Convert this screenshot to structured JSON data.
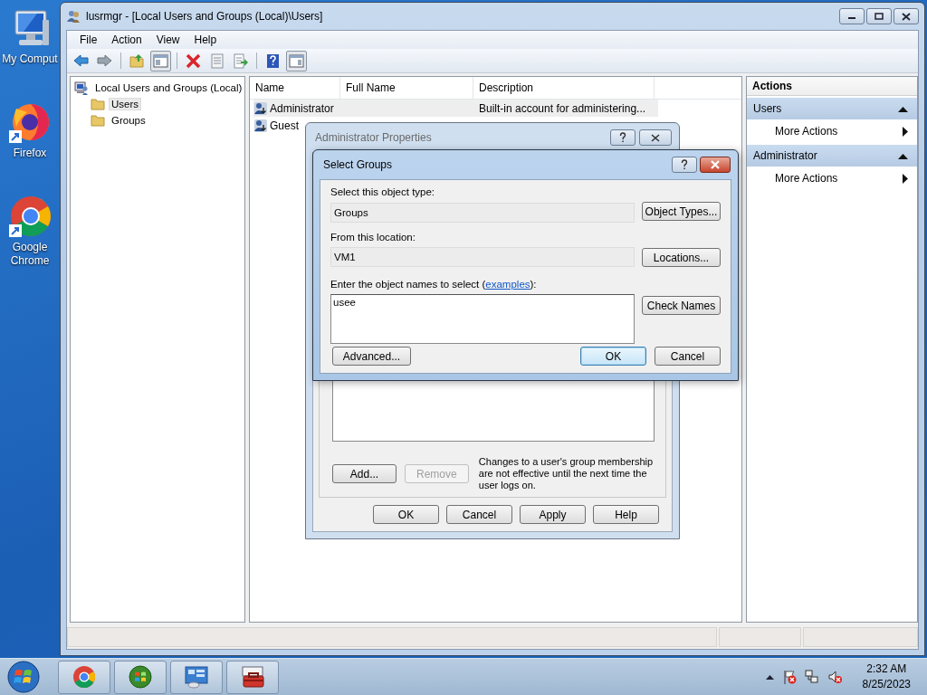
{
  "desktop_icons": [
    {
      "label": "My Comput",
      "kind": "computer"
    },
    {
      "label": "Firefox",
      "kind": "firefox"
    },
    {
      "label": "Google Chrome",
      "kind": "chrome"
    }
  ],
  "main_window": {
    "title": "lusrmgr - [Local Users and Groups (Local)\\Users]",
    "menu": [
      "File",
      "Action",
      "View",
      "Help"
    ],
    "tree": {
      "label": "Local Users and Groups (Local)",
      "children": [
        {
          "label": "Users",
          "selected": true
        },
        {
          "label": "Groups",
          "selected": false
        }
      ]
    },
    "list": {
      "columns": [
        "Name",
        "Full Name",
        "Description"
      ],
      "rows": [
        {
          "name": "Administrator",
          "description": "Built-in account for administering...",
          "selected": true
        },
        {
          "name": "Guest",
          "selected": false
        }
      ]
    },
    "actions": {
      "title": "Actions",
      "sections": [
        {
          "title": "Users",
          "expanded": true,
          "items": [
            "More Actions"
          ]
        },
        {
          "title": "Administrator",
          "expanded": true,
          "items": [
            "More Actions"
          ]
        }
      ]
    }
  },
  "properties_dialog": {
    "title": "Administrator Properties",
    "member_buttons": [
      {
        "label": "Add...",
        "disabled": false
      },
      {
        "label": "Remove",
        "disabled": true
      }
    ],
    "note": "Changes to a user's group membership are not effective until the next time the user logs on.",
    "buttons": [
      "OK",
      "Cancel",
      "Apply",
      "Help"
    ]
  },
  "select_dialog": {
    "title": "Select Groups",
    "object_type_label": "Select this object type:",
    "object_type": "Groups",
    "object_types_button": "Object Types...",
    "location_label": "From this location:",
    "location": "VM1",
    "locations_button": "Locations...",
    "names_label": "Enter the object names to select (",
    "names_link": "examples",
    "names_label_end": "):",
    "names_value": "usee",
    "check_names_button": "Check Names",
    "advanced_button": "Advanced...",
    "buttons": [
      {
        "label": "OK",
        "default": true
      },
      {
        "label": "Cancel",
        "default": false
      }
    ]
  },
  "taskbar": {
    "clock": {
      "time": "2:32 AM",
      "date": "8/25/2023"
    }
  }
}
